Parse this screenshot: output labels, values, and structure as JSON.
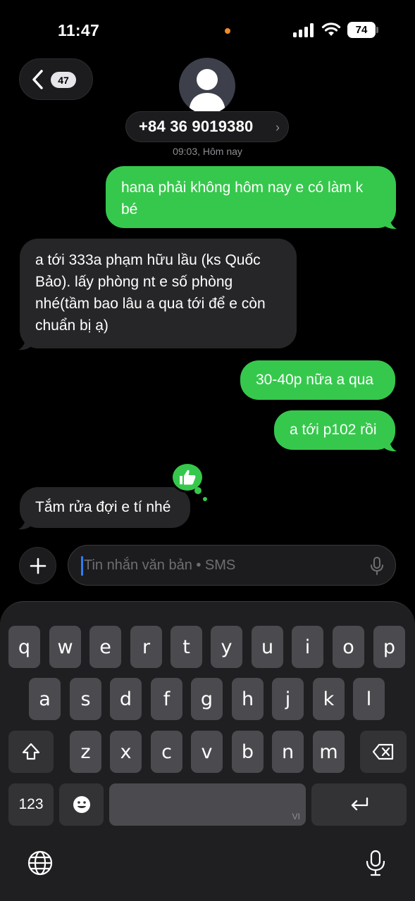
{
  "status_bar": {
    "time": "11:47",
    "battery": "74"
  },
  "header": {
    "unread_count": "47",
    "contact": "+84 36 9019380",
    "timestamp": "09:03, Hôm nay"
  },
  "messages": [
    {
      "direction": "out",
      "text": "hana phải không hôm nay e có làm k bé"
    },
    {
      "direction": "in",
      "text": "a tới 333a phạm hữu lầu (ks Quốc Bảo). lấy phòng nt e số phòng nhé(tầm bao lâu a qua tới để e còn chuẩn bị ạ)"
    },
    {
      "direction": "out",
      "text": "30-40p nữa a qua"
    },
    {
      "direction": "out",
      "text": "a tới p102 rồi"
    },
    {
      "direction": "in",
      "text": "Tắm rửa đợi e tí nhé",
      "reaction": "thumbs-up"
    }
  ],
  "composer": {
    "placeholder": "Tin nhắn văn bản • SMS"
  },
  "keyboard": {
    "row1": [
      "q",
      "w",
      "e",
      "r",
      "t",
      "y",
      "u",
      "i",
      "o",
      "p"
    ],
    "row2": [
      "a",
      "s",
      "d",
      "f",
      "g",
      "h",
      "j",
      "k",
      "l"
    ],
    "row3": [
      "z",
      "x",
      "c",
      "v",
      "b",
      "n",
      "m"
    ],
    "numbers_label": "123",
    "space_lang": "VI"
  },
  "colors": {
    "outgoing": "#36c84c",
    "incoming": "#262628",
    "accent": "#2f7df6"
  },
  "icons": [
    "signal-icon",
    "wifi-icon",
    "battery-icon",
    "chevron-left-icon",
    "avatar-icon",
    "chevron-right-icon",
    "thumbs-up-icon",
    "plus-icon",
    "microphone-icon",
    "shift-icon",
    "backspace-icon",
    "emoji-icon",
    "return-icon",
    "globe-icon",
    "dictation-icon"
  ]
}
